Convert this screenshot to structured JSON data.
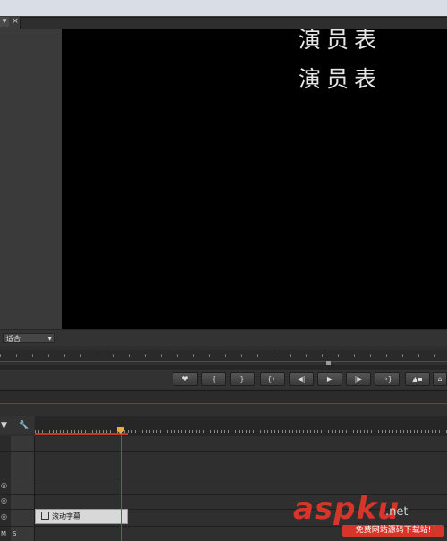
{
  "tabs": {
    "menu_glyph": "▾",
    "close_glyph": "×"
  },
  "program_monitor": {
    "credits": [
      "演员表",
      "演员表"
    ],
    "fit_label": "适合",
    "fit_arrow": "▼"
  },
  "transport": {
    "buttons": [
      {
        "name": "add-marker",
        "glyph": "♥"
      },
      {
        "name": "mark-in",
        "glyph": "{"
      },
      {
        "name": "mark-out",
        "glyph": "}"
      },
      {
        "name": "go-to-in",
        "glyph": "{←"
      },
      {
        "name": "step-back",
        "glyph": "◀|"
      },
      {
        "name": "play",
        "glyph": "▶"
      },
      {
        "name": "step-forward",
        "glyph": "|▶"
      },
      {
        "name": "go-to-out",
        "glyph": "→}"
      },
      {
        "name": "lift",
        "glyph": "▲▪"
      },
      {
        "name": "extract",
        "glyph": "⌂"
      }
    ]
  },
  "timeline": {
    "marker_glyph": "▼",
    "wrench_glyph": "🔧",
    "eye_glyph": "◎",
    "track_m_label": "M",
    "track_s_label": "S",
    "clip_label": "滚动字幕"
  },
  "watermark": {
    "main": "aspku",
    "sub": ".net",
    "tag": "免费网站源码下载站!"
  },
  "colors": {
    "accent": "#c0392b",
    "watermark": "#d8352a",
    "playhead": "#e0b040"
  }
}
